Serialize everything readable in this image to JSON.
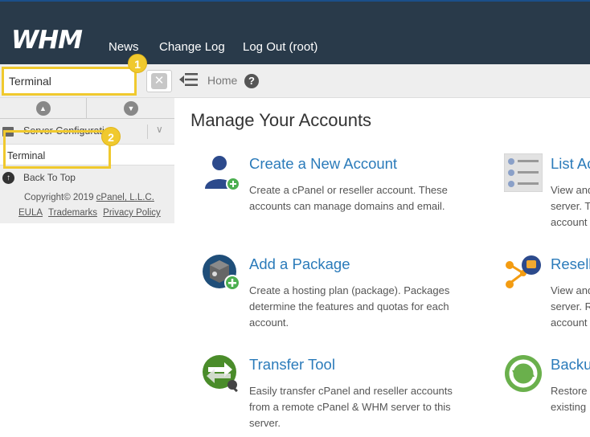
{
  "header": {
    "logo": "WHM",
    "nav": [
      "News",
      "Change Log",
      "Log Out (root)"
    ]
  },
  "search": {
    "value": "Terminal",
    "badge": "1"
  },
  "breadcrumb": {
    "home": "Home",
    "help_glyph": "?"
  },
  "sidebar": {
    "category": "Server Configuration",
    "result": "Terminal",
    "result_badge": "2",
    "back_to_top": "Back To Top",
    "copyright_prefix": "Copyright© 2019 ",
    "copyright_company": "cPanel, L.L.C.",
    "links": [
      "EULA",
      "Trademarks",
      "Privacy Policy"
    ]
  },
  "main": {
    "title": "Manage Your Accounts",
    "cards": [
      {
        "title": "Create a New Account",
        "desc": "Create a cPanel or reseller account. These accounts can manage domains and email.",
        "icon": "user-add-icon"
      },
      {
        "title": "Add a Package",
        "desc": "Create a hosting plan (package). Packages determine the features and quotas for each account.",
        "icon": "package-add-icon"
      },
      {
        "title": "Transfer Tool",
        "desc": "Easily transfer cPanel and reseller accounts from a remote cPanel & WHM server to this server.",
        "icon": "transfer-icon"
      }
    ],
    "right_cards": [
      {
        "title": "List Ac",
        "lines": [
          "View and",
          "server. T",
          "account"
        ],
        "icon": "list-accounts-icon"
      },
      {
        "title": "Resell",
        "lines": [
          "View and",
          "server. R",
          "account"
        ],
        "icon": "reseller-icon"
      },
      {
        "title": "Backu",
        "lines": [
          "Restore",
          "existing"
        ],
        "icon": "backup-icon"
      }
    ]
  },
  "colors": {
    "header_bg": "#293a4a",
    "highlight": "#f0c92e",
    "link": "#2b7bba"
  }
}
